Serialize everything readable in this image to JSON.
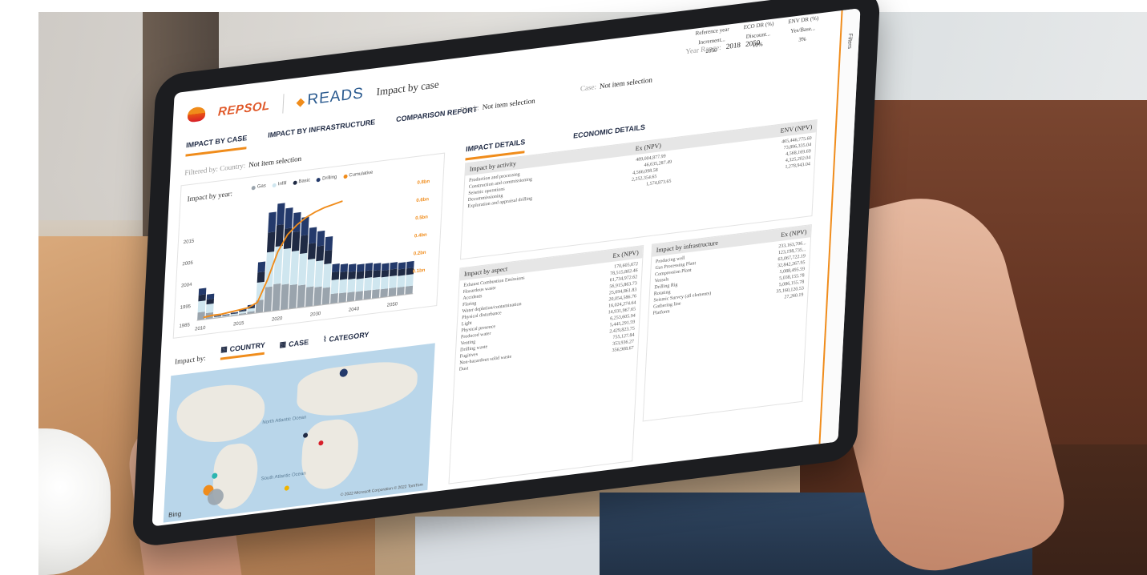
{
  "header": {
    "brand": "REPSOL",
    "product": "READS",
    "page_title": "Impact by case"
  },
  "tabs": [
    "IMPACT BY CASE",
    "IMPACT BY INFRASTRUCTURE",
    "COMPARISON REPORT"
  ],
  "filters": {
    "filtered_by_label": "Filtered by:",
    "country_label": "Country:",
    "country_value": "Not item selection",
    "block_label": "Block:",
    "block_value": "Not item selection",
    "case_label": "Case:",
    "case_value": "Not item selection",
    "year_range_label": "Year Range:",
    "year_from": "2018",
    "year_to": "2050"
  },
  "top_filters": [
    {
      "label": "Reference year",
      "sub": "Increment...",
      "value": "2050"
    },
    {
      "label": "ECO DR (%)",
      "sub": "Discount...",
      "value": "10%"
    },
    {
      "label": "ENV DR (%)",
      "sub": "Yes/Base...",
      "value": "3%"
    }
  ],
  "filters_pane_label": "Filters",
  "chart_panel": {
    "title": "Impact by year:",
    "legend": [
      {
        "name": "Gas",
        "color": "#9aa4ad"
      },
      {
        "name": "Infill",
        "color": "#cfe6ef"
      },
      {
        "name": "Basic",
        "color": "#1f2a44"
      },
      {
        "name": "Drilling",
        "color": "#243a6b"
      },
      {
        "name": "Cumulative",
        "color": "#f08c1b"
      }
    ]
  },
  "chart_data": {
    "type": "bar",
    "title": "",
    "x_ticks": [
      "2010",
      "2015",
      "2020",
      "2030",
      "2040",
      "2050"
    ],
    "y_left_ticks": [
      "2015",
      "2005",
      "2004",
      "1995",
      "1985"
    ],
    "y_right_ticks": [
      "0.8bn",
      "0.6bn",
      "0.5bn",
      "0.4bn",
      "0.2bn",
      "0.1bn"
    ],
    "y_right_label": "Cumulative",
    "bars_stack_heights": [
      0.28,
      0.22,
      0.02,
      0.02,
      0.03,
      0.05,
      0.08,
      0.45,
      0.88,
      0.95,
      0.9,
      0.85,
      0.8,
      0.7,
      0.66,
      0.6,
      0.35,
      0.34,
      0.33,
      0.32,
      0.32,
      0.31,
      0.3,
      0.3,
      0.29,
      0.29
    ],
    "cumulative_line": [
      0.02,
      0.03,
      0.03,
      0.04,
      0.05,
      0.06,
      0.1,
      0.3,
      0.55,
      0.7,
      0.78,
      0.84,
      0.88,
      0.91,
      0.93,
      0.95
    ]
  },
  "impact_by": {
    "label": "Impact by:",
    "tabs": [
      "COUNTRY",
      "CASE",
      "CATEGORY"
    ]
  },
  "map": {
    "provider": "Bing",
    "copyright": "© 2022 Microsoft Corporation © 2022 TomTom",
    "labels": [
      "North Atlantic Ocean",
      "South Atlantic Ocean"
    ],
    "points": [
      {
        "color": "#243a6b"
      },
      {
        "color": "#1f2a44"
      },
      {
        "color": "#d71f2a"
      },
      {
        "color": "#2bb5b0"
      },
      {
        "color": "#f08c1b"
      },
      {
        "color": "#9aa4ad"
      },
      {
        "color": "#f0b400"
      }
    ]
  },
  "right_tabs": [
    "IMPACT DETAILS",
    "ECONOMIC DETAILS"
  ],
  "activity_table": {
    "title": "Impact by activity",
    "col1": "Ex (NPV)",
    "col2": "ENV (NPV)",
    "rows": [
      "Production and processing",
      "Construction and commissioning",
      "Seismic operations",
      "Decommissioning",
      "Exploration and appraisal drilling"
    ],
    "col1_values": [
      "489,004,877.99",
      "46,635,287.49",
      "4,566,098.58",
      "2,252,354.65",
      "1,574,873.65"
    ],
    "col2_values": [
      "465,446,775.60",
      "73,896,335.04",
      "4,568,169.69",
      "4,325,202.04",
      "1,278,943.04"
    ]
  },
  "aspect_table": {
    "title": "Impact by aspect",
    "col": "Ex (NPV)",
    "rows": [
      "Exhaust Combustion Emissions",
      "Hazardous waste",
      "Accidents",
      "Flaring",
      "Water depletion/contamination",
      "Physical disturbance",
      "Light",
      "Physical presence",
      "Produced water",
      "Venting",
      "Drilling waste",
      "Fugitives",
      "Non-hazardous solid waste",
      "Dust"
    ],
    "values": [
      "170,605,672",
      "78,515,802.46",
      "61,734,972.62",
      "56,915,863.73",
      "25,694,861.83",
      "20,054,586.76",
      "16,024,274.64",
      "14,931,967.65",
      "6,253,605.94",
      "5,445,291.59",
      "2,429,823.75",
      "755,127.84",
      "353,936.27",
      "356,908.67"
    ]
  },
  "infra_table": {
    "title": "Impact by infrastructure",
    "col": "Ex (NPV)",
    "rows": [
      "Producing well",
      "Gas Processing Plant",
      "Compression Plant",
      "Vessels",
      "Drilling Rig",
      "Rotating",
      "Seismic Survey (all elements)",
      "Gathering line",
      "Platform"
    ],
    "values": [
      "233,163,706...",
      "123,198,735...",
      "63,067,722.19",
      "32,842,267.95",
      "5,088,495.59",
      "5,038,155.78",
      "5,086,155.78",
      "35,160,120.53",
      "27,260.19"
    ]
  }
}
